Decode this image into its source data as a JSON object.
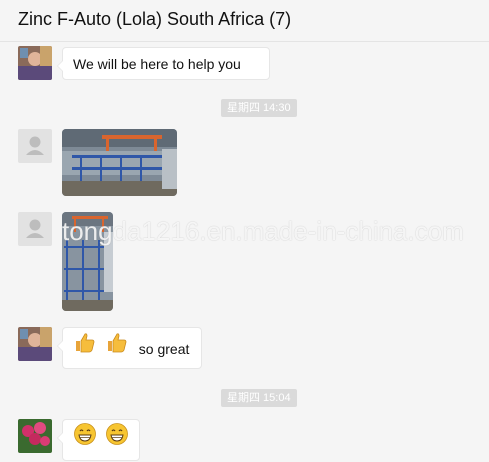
{
  "header": {
    "title": "Zinc F-Auto (Lola) South Africa (7)"
  },
  "messages": {
    "m1": {
      "text": "We will be here to help you",
      "avatar_icon": "user-photo-avatar"
    },
    "time1": "星期四 14:30",
    "m2": {
      "image": "factory-plating-line-photo",
      "avatar_icon": "default-user-avatar"
    },
    "m3": {
      "image": "factory-racks-photo",
      "avatar_icon": "default-user-avatar"
    },
    "m4": {
      "emojis": [
        "thumbs-up-emoji",
        "thumbs-up-emoji"
      ],
      "text": "so great",
      "avatar_icon": "user-photo-avatar"
    },
    "time2": "星期四 15:04",
    "m5": {
      "emojis": [
        "grinning-emoji",
        "grinning-emoji"
      ],
      "avatar_icon": "flowers-avatar"
    }
  },
  "watermark": "tongda1216.en.made-in-china.com",
  "colors": {
    "background": "#f5f5f5",
    "bubble": "#ffffff",
    "timestamp_bg": "#dadada"
  }
}
